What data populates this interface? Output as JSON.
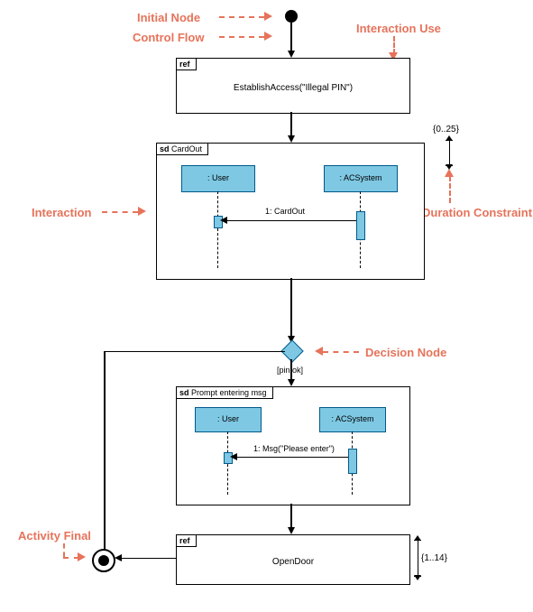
{
  "labels": {
    "initial_node": "Initial Node",
    "control_flow": "Control Flow",
    "interaction_use": "Interaction Use",
    "interaction": "Interaction",
    "duration_constraint": "Duration Constraint",
    "decision_node": "Decision Node",
    "activity_final": "Activity Final"
  },
  "nodes": {
    "initial": {
      "type": "InitialNode"
    },
    "ref1": {
      "kind": "ref",
      "text": "EstablishAccess(\"Illegal PIN\")"
    },
    "sd1": {
      "kind": "sd",
      "name": "CardOut",
      "lifelines": {
        "user": ": User",
        "acsystem": ": ACSystem"
      },
      "message": "1: CardOut"
    },
    "decision": {
      "type": "DecisionNode"
    },
    "guard_pin": "[pin ok]",
    "sd2": {
      "kind": "sd",
      "name": "Prompt entering msg",
      "lifelines": {
        "user": ": User",
        "acsystem": ": ACSystem"
      },
      "message": "1: Msg(\"Please enter\")"
    },
    "ref2": {
      "kind": "ref",
      "text": "OpenDoor"
    },
    "final": {
      "type": "ActivityFinalNode"
    }
  },
  "duration_constraints": {
    "dc1": "{0..25}",
    "dc2": "{1..14}"
  }
}
